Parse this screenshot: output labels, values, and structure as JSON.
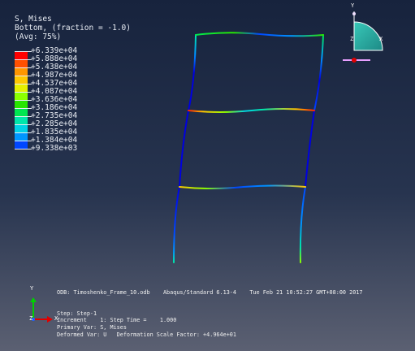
{
  "legend": {
    "title": "S, Mises",
    "section": "Bottom, (fraction = -1.0)",
    "averaging": "(Avg: 75%)",
    "levels": [
      {
        "label": "+6.339e+04",
        "color": "#ff0000"
      },
      {
        "label": "+5.888e+04",
        "color": "#ff5000"
      },
      {
        "label": "+5.438e+04",
        "color": "#ff9600"
      },
      {
        "label": "+4.987e+04",
        "color": "#ffc800"
      },
      {
        "label": "+4.537e+04",
        "color": "#e6f000"
      },
      {
        "label": "+4.087e+04",
        "color": "#8cff00"
      },
      {
        "label": "+3.636e+04",
        "color": "#28e600"
      },
      {
        "label": "+3.186e+04",
        "color": "#00e650"
      },
      {
        "label": "+2.735e+04",
        "color": "#00e6aa"
      },
      {
        "label": "+2.285e+04",
        "color": "#00d2e6"
      },
      {
        "label": "+1.835e+04",
        "color": "#0096ff"
      },
      {
        "label": "+1.384e+04",
        "color": "#0046ff"
      },
      {
        "label": "+9.338e+03",
        "color": "#0000e0"
      }
    ]
  },
  "triad_top": {
    "y": "Y",
    "z": "Z",
    "x": "X"
  },
  "triad_bottom": {
    "y": "Y",
    "z": "Z",
    "x": "X"
  },
  "odb_line": "ODB: Timoshenko_Frame_10.odb    Abaqus/Standard 6.13-4    Tue Feb 21 10:52:27 GMT+08:00 2017",
  "step_line": "Step: Step-1",
  "increment_line": "Increment    1: Step Time =    1.000",
  "primary_var_line": "Primary Var: S, Mises",
  "deformed_var_line": "Deformed Var: U   Deformation Scale Factor: +4.964e+01"
}
